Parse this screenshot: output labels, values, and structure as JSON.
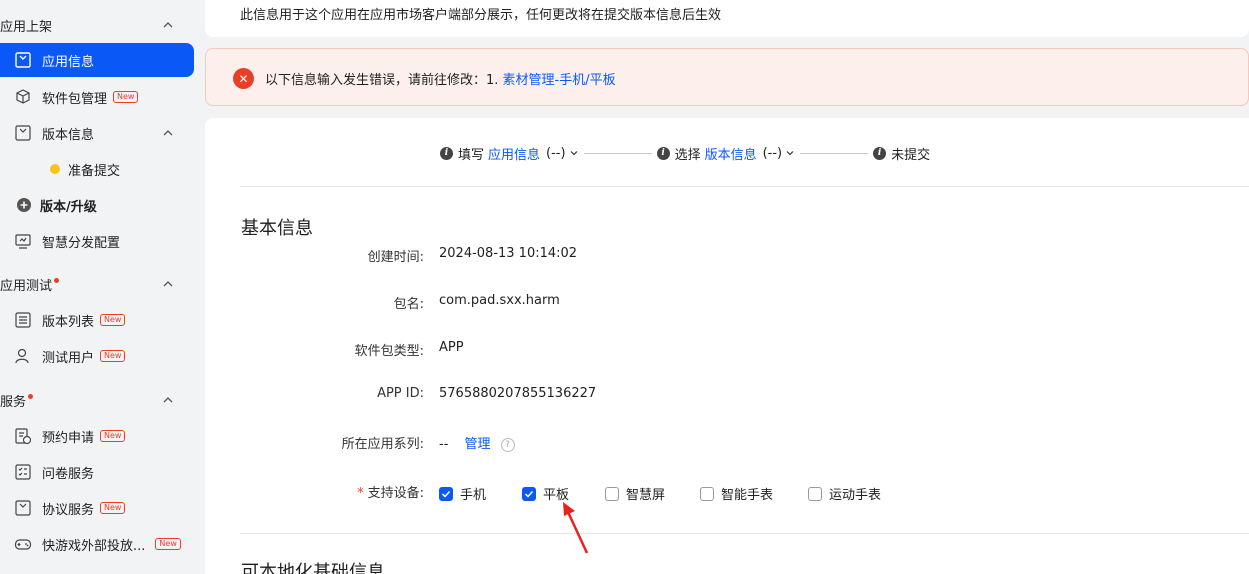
{
  "sidebar": {
    "section_app": "应用上架",
    "items_app": [
      {
        "label": "应用信息",
        "icon": "app-info-icon"
      },
      {
        "label": "软件包管理",
        "icon": "package-icon",
        "badge": "New"
      },
      {
        "label": "版本信息",
        "icon": "version-icon"
      }
    ],
    "sub_prepare": "准备提交",
    "version_upgrade": "版本/升级",
    "smart_dist": "智慧分发配置",
    "section_test": "应用测试",
    "items_test": [
      {
        "label": "版本列表",
        "badge": "New"
      },
      {
        "label": "测试用户",
        "badge": "New"
      }
    ],
    "section_service": "服务",
    "items_service": [
      {
        "label": "预约申请",
        "badge": "New"
      },
      {
        "label": "问卷服务"
      },
      {
        "label": "协议服务",
        "badge": "New"
      },
      {
        "label": "快游戏外部投放...",
        "badge": "New"
      }
    ]
  },
  "notice": "此信息用于这个应用在应用市场客户端部分展示，任何更改将在提交版本信息后生效",
  "error": {
    "prefix": "以下信息输入发生错误，请前往修改：1.",
    "link": "素材管理-手机/平板"
  },
  "steps": {
    "s1_pre": "填写",
    "s1_link": "应用信息",
    "s1_val": "(--)",
    "s2_pre": "选择",
    "s2_link": "版本信息",
    "s2_val": "(--)",
    "s3": "未提交"
  },
  "basic": {
    "title": "基本信息",
    "created_label": "创建时间:",
    "created_value": "2024-08-13 10:14:02",
    "pkg_label": "包名:",
    "pkg_value": "com.pad.sxx.harm",
    "type_label": "软件包类型:",
    "type_value": "APP",
    "appid_label": "APP ID:",
    "appid_value": "5765880207855136227",
    "series_label": "所在应用系列:",
    "series_value": "--",
    "series_manage": "管理",
    "devices_label": "支持设备:",
    "devices": [
      {
        "label": "手机",
        "checked": true
      },
      {
        "label": "平板",
        "checked": true
      },
      {
        "label": "智慧屏",
        "checked": false
      },
      {
        "label": "智能手表",
        "checked": false
      },
      {
        "label": "运动手表",
        "checked": false
      }
    ]
  },
  "localized_title": "可本地化基础信息",
  "colors": {
    "accent": "#0a59f7",
    "error": "#e84026",
    "annotation": "#e8221b"
  }
}
